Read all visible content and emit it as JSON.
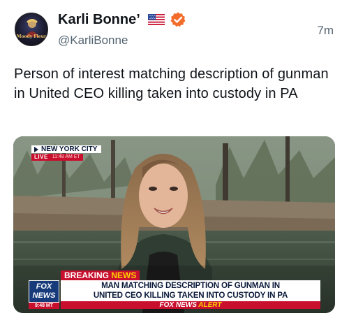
{
  "post": {
    "author": {
      "display_name": "Karli Bonne’",
      "handle": "@KarliBonne",
      "avatar_label": "Moody Fleur",
      "flag_icon": "us-flag-icon",
      "verified_icon": "verified-badge-icon",
      "verified_color": "#f26c2c"
    },
    "timestamp": "7m",
    "text": "Person of interest matching description of gunman in United CEO killing taken into custody in PA"
  },
  "media": {
    "location_tag": {
      "city": "NEW YORK CITY",
      "live_label": "LIVE",
      "live_time": "11:48 AM ET"
    },
    "lower_third": {
      "breaking_label": "BREAKING",
      "breaking_news_word": "NEWS",
      "headline_line1": "MAN MATCHING DESCRIPTION OF GUNMAN IN",
      "headline_line2": "UNITED CEO KILLING TAKEN INTO CUSTODY IN PA",
      "alert_brand": "FOX NEWS",
      "alert_word": "ALERT",
      "logo_line1": "FOX",
      "logo_line2": "NEWS",
      "clock": "9:48 MT"
    }
  },
  "colors": {
    "text_primary": "#0f1419",
    "text_secondary": "#536471",
    "fox_red": "#c8102e",
    "fox_blue": "#163a7a",
    "fox_yellow": "#ffd200"
  }
}
